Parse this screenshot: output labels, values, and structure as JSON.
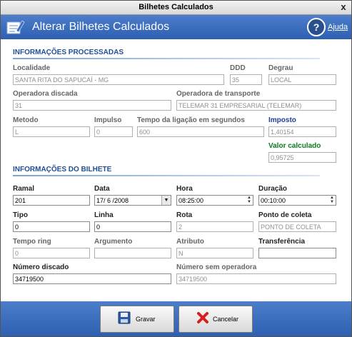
{
  "window": {
    "title": "Bilhetes Calculados",
    "close": "x"
  },
  "header": {
    "title": "Alterar Bilhetes Calculados",
    "help_label": "Ajuda",
    "help_symbol": "?"
  },
  "sections": {
    "processed": "INFORMAÇÕES PROCESSADAS",
    "ticket": "INFORMAÇÕES DO BILHETE"
  },
  "fields": {
    "localidade": {
      "label": "Localidade",
      "value": "SANTA RITA DO SAPUCAÍ - MG"
    },
    "ddd": {
      "label": "DDD",
      "value": "35"
    },
    "degrau": {
      "label": "Degrau",
      "value": "LOCAL"
    },
    "operadora_discada": {
      "label": "Operadora discada",
      "value": "31"
    },
    "operadora_transporte": {
      "label": "Operadora de transporte",
      "value": "TELEMAR 31 EMPRESARIAL (TELEMAR)"
    },
    "metodo": {
      "label": "Metodo",
      "value": "L"
    },
    "impulso": {
      "label": "Impulso",
      "value": "0"
    },
    "tempo_ligacao": {
      "label": "Tempo da ligação em segundos",
      "value": "600"
    },
    "imposto": {
      "label": "Imposto",
      "value": "1,40154"
    },
    "valor_calculado": {
      "label": "Valor calculado",
      "value": "0,95725"
    },
    "ramal": {
      "label": "Ramal",
      "value": "201"
    },
    "data": {
      "label": "Data",
      "value": "17/ 6 /2008"
    },
    "hora": {
      "label": "Hora",
      "value": "08:25:00"
    },
    "duracao": {
      "label": "Duração",
      "value": "00:10:00"
    },
    "tipo": {
      "label": "Tipo",
      "value": "0"
    },
    "linha": {
      "label": "Linha",
      "value": "0"
    },
    "rota": {
      "label": "Rota",
      "value": "2"
    },
    "ponto_coleta": {
      "label": "Ponto de coleta",
      "value": "PONTO DE COLETA"
    },
    "tempo_ring": {
      "label": "Tempo ring",
      "value": "0"
    },
    "argumento": {
      "label": "Argumento",
      "value": ""
    },
    "atributo": {
      "label": "Atributo",
      "value": "N"
    },
    "transferencia": {
      "label": "Transferência",
      "value": ""
    },
    "numero_discado": {
      "label": "Número discado",
      "value": "34719500"
    },
    "numero_sem_operadora": {
      "label": "Número sem operadora",
      "value": "34719500"
    }
  },
  "buttons": {
    "save": "Gravar",
    "cancel": "Cancelar"
  },
  "colors": {
    "header_blue": "#3a6bbf",
    "section_blue": "#1f4f95",
    "imposto_blue": "#1f3f9a",
    "valor_green": "#0c7a1e",
    "cancel_red": "#d62020"
  },
  "icons": {
    "header": "edit-list-icon",
    "help": "help-icon",
    "save": "floppy-disk-icon",
    "cancel": "red-x-icon"
  }
}
